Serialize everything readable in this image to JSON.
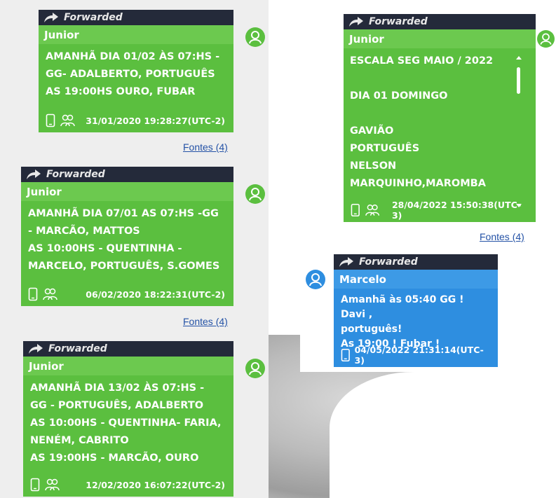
{
  "forwarded_label": "Forwarded",
  "fontes_label": "Fontes (4)",
  "colors": {
    "bubble_green": "#5bbf3f",
    "bubble_blue": "#2e8ee0",
    "forward_bar": "#242a3a",
    "link": "#2452a6"
  },
  "icons": {
    "forward": "forward-arrow-icon",
    "avatar": "user-avatar-icon",
    "phone": "phone-icon",
    "group": "group-icon"
  },
  "messages": [
    {
      "sender": "Junior",
      "text": "AMANHÃ DIA 01/02 ÀS 07:HS -\nGG- ADALBERTO, PORTUGUÊS\nAS 19:00HS OURO, FUBAR",
      "timestamp": "31/01/2020 19:28:27(UTC-2)"
    },
    {
      "sender": "Junior",
      "text": "AMANHÃ DIA 07/01 AS 07:HS -GG\n- MARCÃO, MATTOS\nAS 10:00HS  - QUENTINHA -\nMARCELO, PORTUGUÊS, S.GOMES",
      "timestamp": "06/02/2020 18:22:31(UTC-2)"
    },
    {
      "sender": "Junior",
      "text": "AMANHÃ DIA 13/02 ÀS 07:HS -\nGG - PORTUGUÊS, ADALBERTO\nAS 10:00HS - QUENTINHA- FARIA,\nNENÉM, CABRITO\nAS 19:00HS - MARCÃO, OURO",
      "timestamp": "12/02/2020 16:07:22(UTC-2)"
    },
    {
      "sender": "Junior",
      "text": "ESCALA SEG MAIO / 2022\n\nDIA 01 DOMINGO\n\nGAVIÃO\nPORTUGUÊS\nNELSON\nMARQUINHO,MAROMBA",
      "timestamp": "28/04/2022 15:50:38(UTC-3)"
    },
    {
      "sender": "Marcelo",
      "text": "Amanhã às 05:40 GG ! Davi ,\nportuguês!\nAs 19:00 ! Fubar !",
      "timestamp": "04/05/2022 21:31:14(UTC-3)"
    }
  ]
}
